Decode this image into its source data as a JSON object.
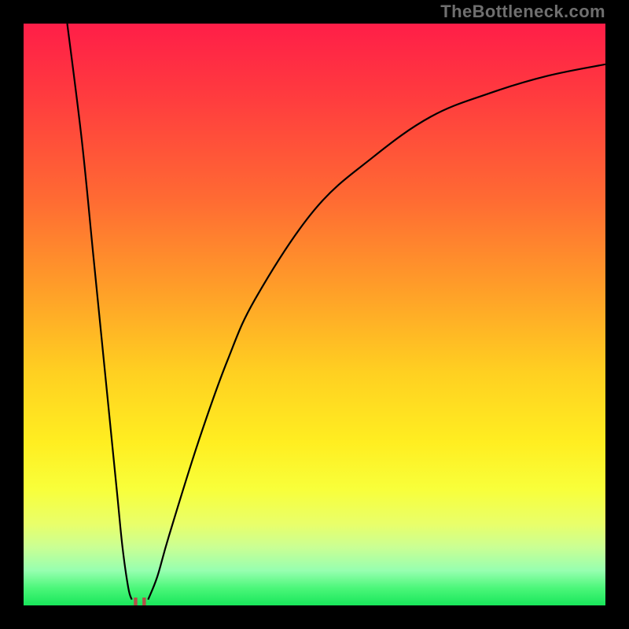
{
  "attribution": "TheBottleneck.com",
  "marker_glyph": "u",
  "chart_data": {
    "type": "line",
    "title": "",
    "xlabel": "",
    "ylabel": "",
    "xlim": [
      0,
      100
    ],
    "ylim": [
      0,
      100
    ],
    "x_ticks": [],
    "y_ticks": [],
    "legend": [],
    "background": "red-to-green vertical gradient (bottleneck-style heatmap)",
    "series": [
      {
        "name": "left-arm",
        "values": [
          {
            "x": 7.5,
            "y": 100
          },
          {
            "x": 10.0,
            "y": 80
          },
          {
            "x": 12.0,
            "y": 60
          },
          {
            "x": 14.0,
            "y": 40
          },
          {
            "x": 16.0,
            "y": 20
          },
          {
            "x": 17.0,
            "y": 10
          },
          {
            "x": 18.0,
            "y": 3
          },
          {
            "x": 18.6,
            "y": 1
          }
        ]
      },
      {
        "name": "right-arm",
        "values": [
          {
            "x": 21.4,
            "y": 1
          },
          {
            "x": 23.0,
            "y": 5
          },
          {
            "x": 25.0,
            "y": 12
          },
          {
            "x": 30.0,
            "y": 28
          },
          {
            "x": 35.0,
            "y": 42
          },
          {
            "x": 40.0,
            "y": 53
          },
          {
            "x": 50.0,
            "y": 68
          },
          {
            "x": 60.0,
            "y": 77
          },
          {
            "x": 70.0,
            "y": 84
          },
          {
            "x": 80.0,
            "y": 88
          },
          {
            "x": 90.0,
            "y": 91
          },
          {
            "x": 100.0,
            "y": 93
          }
        ]
      }
    ],
    "marker": {
      "x": 20,
      "y": 0.5,
      "shape": "u",
      "color": "#b44e49"
    }
  },
  "colors": {
    "curve": "#000000",
    "marker": "#b44e49",
    "attribution": "#6f6f6f",
    "frame": "#000000"
  }
}
